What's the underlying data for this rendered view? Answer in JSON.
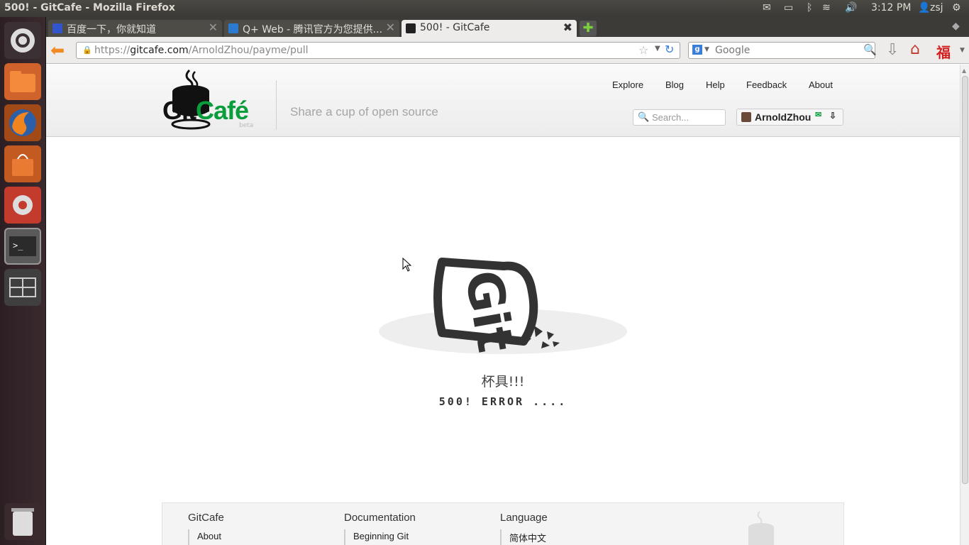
{
  "window": {
    "title": "500! - GitCafe - Mozilla Firefox"
  },
  "tray": {
    "time": "3:12 PM",
    "user": "zsj"
  },
  "tabs": [
    {
      "label": "百度一下，你就知道"
    },
    {
      "label": "Q+ Web - 腾讯官方为您提供..."
    },
    {
      "label": "500! - GitCafe"
    }
  ],
  "url": {
    "host": "gitcafe.com",
    "protocol": "https://",
    "path": "/ArnoldZhou/payme/pull"
  },
  "browser_search": {
    "placeholder": "Google"
  },
  "site": {
    "logo_git": "Git",
    "logo_cafe": "Café",
    "logo_beta": "beta",
    "tagline": "Share a cup of open source",
    "nav": [
      "Explore",
      "Blog",
      "Help",
      "Feedback",
      "About"
    ],
    "search_placeholder": "Search...",
    "username": "ArnoldZhou"
  },
  "error": {
    "title": "杯具!!!",
    "code": "500!  ERROR  ...."
  },
  "footer": {
    "columns": [
      {
        "heading": "GitCafe",
        "link": "About"
      },
      {
        "heading": "Documentation",
        "link": "Beginning Git"
      },
      {
        "heading": "Language",
        "link": "简体中文"
      }
    ]
  },
  "colors": {
    "brand_green": "#0a9d3c",
    "launcher_bg": "#2c1f24"
  }
}
